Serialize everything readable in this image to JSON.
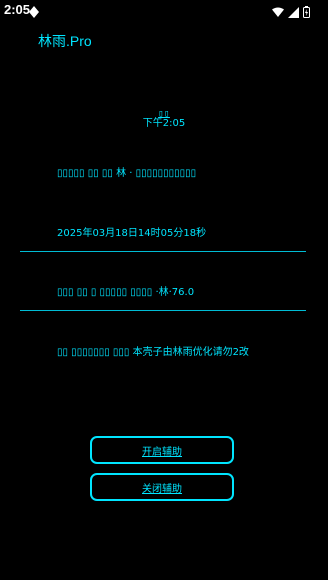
{
  "status_bar": {
    "time": "2:05"
  },
  "app": {
    "title": "林雨.Pro"
  },
  "header": {
    "garbled_title": "▯▯",
    "clock": "下午2:05"
  },
  "lines": {
    "line1": "▯▯▯▯▯ ▯▯ ▯▯ 林 · ▯▯▯▯▯▯▯▯▯▯▯",
    "datetime": "2025年03月18日14时05分18秒",
    "line3": "▯▯▯ ▯▯ ▯ ▯▯▯▯▯ ▯▯▯▯ ·林·76.0",
    "line4": "▯▯ ▯▯▯▯▯▯▯ ▯▯▯ 本壳子由林雨优化请勿2改"
  },
  "buttons": {
    "enable_label": "开启辅助",
    "disable_label": "关闭辅助"
  },
  "colors": {
    "accent": "#00e5ff",
    "background": "#000000",
    "divider": "#00bcd4"
  }
}
